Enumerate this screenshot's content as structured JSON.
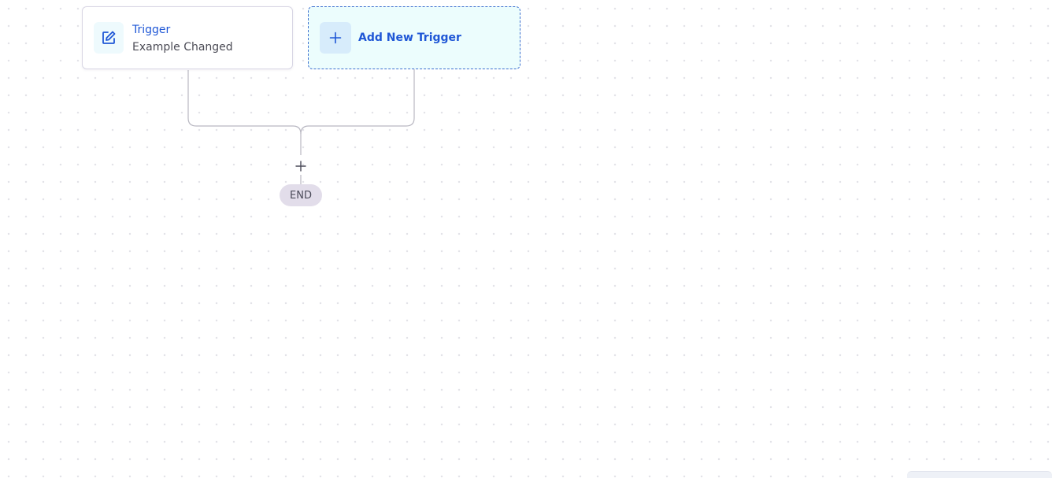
{
  "canvas": {
    "dot_color": "#e3e3e8",
    "background": "#ffffff"
  },
  "trigger_card": {
    "title": "Trigger",
    "subtitle": "Example Changed",
    "icon": "edit-icon",
    "title_color": "#1f57d6"
  },
  "add_trigger_card": {
    "label": "Add New Trigger",
    "icon": "plus-icon",
    "background": "#ecfdfd",
    "border_color": "#3d6fcf"
  },
  "flow": {
    "add_step_icon": "plus-icon",
    "end_label": "END",
    "connector_color": "#b9b8c2"
  }
}
